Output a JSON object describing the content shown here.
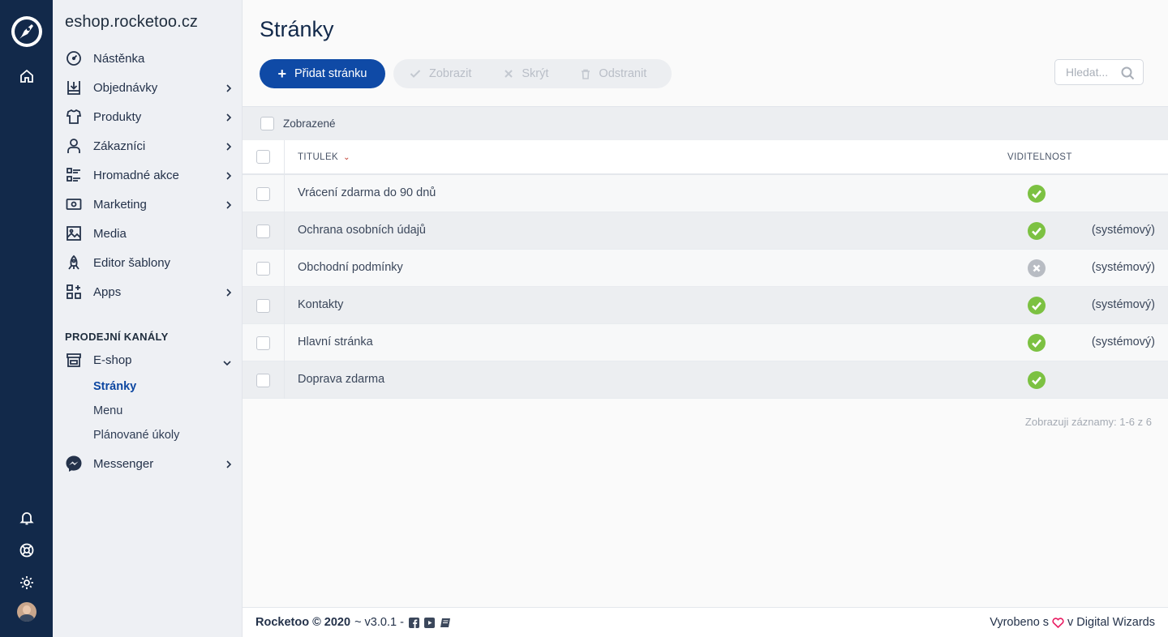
{
  "sidebar": {
    "shop_title": "eshop.rocketoo.cz",
    "items": [
      {
        "label": "Nástěnka",
        "icon": "dashboard-icon"
      },
      {
        "label": "Objednávky",
        "icon": "inbox-icon"
      },
      {
        "label": "Produkty",
        "icon": "shirt-icon"
      },
      {
        "label": "Zákazníci",
        "icon": "user-icon"
      },
      {
        "label": "Hromadné akce",
        "icon": "checklist-icon"
      },
      {
        "label": "Marketing",
        "icon": "money-icon"
      },
      {
        "label": "Media",
        "icon": "image-icon"
      },
      {
        "label": "Editor šablony",
        "icon": "rocket-icon"
      },
      {
        "label": "Apps",
        "icon": "apps-icon"
      }
    ],
    "section_title": "PRODEJNÍ KANÁLY",
    "eshop": {
      "label": "E-shop",
      "icon": "store-icon"
    },
    "eshop_sub": [
      "Stránky",
      "Menu",
      "Plánované úkoly"
    ],
    "messenger": {
      "label": "Messenger",
      "icon": "messenger-icon"
    }
  },
  "main": {
    "title": "Stránky",
    "add_button": "Přidat stránku",
    "show_button": "Zobrazit",
    "hide_button": "Skrýt",
    "delete_button": "Odstranit",
    "search_placeholder": "Hledat..."
  },
  "filter": {
    "label": "Zobrazené"
  },
  "table": {
    "columns": {
      "title": "TITULEK",
      "visibility": "VIDITELNOST"
    },
    "rows": [
      {
        "title": "Vrácení zdarma do 90 dnů",
        "visible": true,
        "system": ""
      },
      {
        "title": "Ochrana osobních údajů",
        "visible": true,
        "system": "(systémový)"
      },
      {
        "title": "Obchodní podmínky",
        "visible": false,
        "system": "(systémový)"
      },
      {
        "title": "Kontakty",
        "visible": true,
        "system": "(systémový)"
      },
      {
        "title": "Hlavní stránka",
        "visible": true,
        "system": "(systémový)"
      },
      {
        "title": "Doprava zdarma",
        "visible": true,
        "system": ""
      }
    ]
  },
  "records": "Zobrazuji záznamy: 1-6 z 6",
  "footer": {
    "brand": "Rocketoo © 2020",
    "version": "~ v3.0.1 -",
    "made_prefix": "Vyrobeno s",
    "made_suffix": "v Digital Wizards"
  },
  "colors": {
    "rail": "#12294a",
    "primary": "#0f4aa6",
    "visible_ok": "#7cc142",
    "hidden": "#b8bcc3",
    "heart": "#e91e63"
  }
}
